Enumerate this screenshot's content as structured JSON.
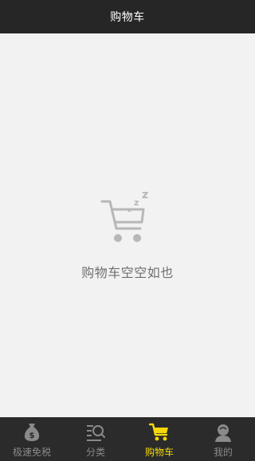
{
  "header": {
    "title": "购物车"
  },
  "empty_state": {
    "message": "购物车空空如也",
    "icon": "sleeping-cart-icon"
  },
  "tabs": [
    {
      "label": "极速免税",
      "icon": "money-bag-icon",
      "active": false
    },
    {
      "label": "分类",
      "icon": "category-search-icon",
      "active": false
    },
    {
      "label": "购物车",
      "icon": "cart-icon",
      "active": true
    },
    {
      "label": "我的",
      "icon": "user-icon",
      "active": false
    }
  ],
  "colors": {
    "header_bg": "#262626",
    "tabbar_bg": "#2b2b2b",
    "active_tab": "#f5d90a",
    "inactive_tab": "#8a8a8a",
    "page_bg": "#f2f2f2"
  }
}
